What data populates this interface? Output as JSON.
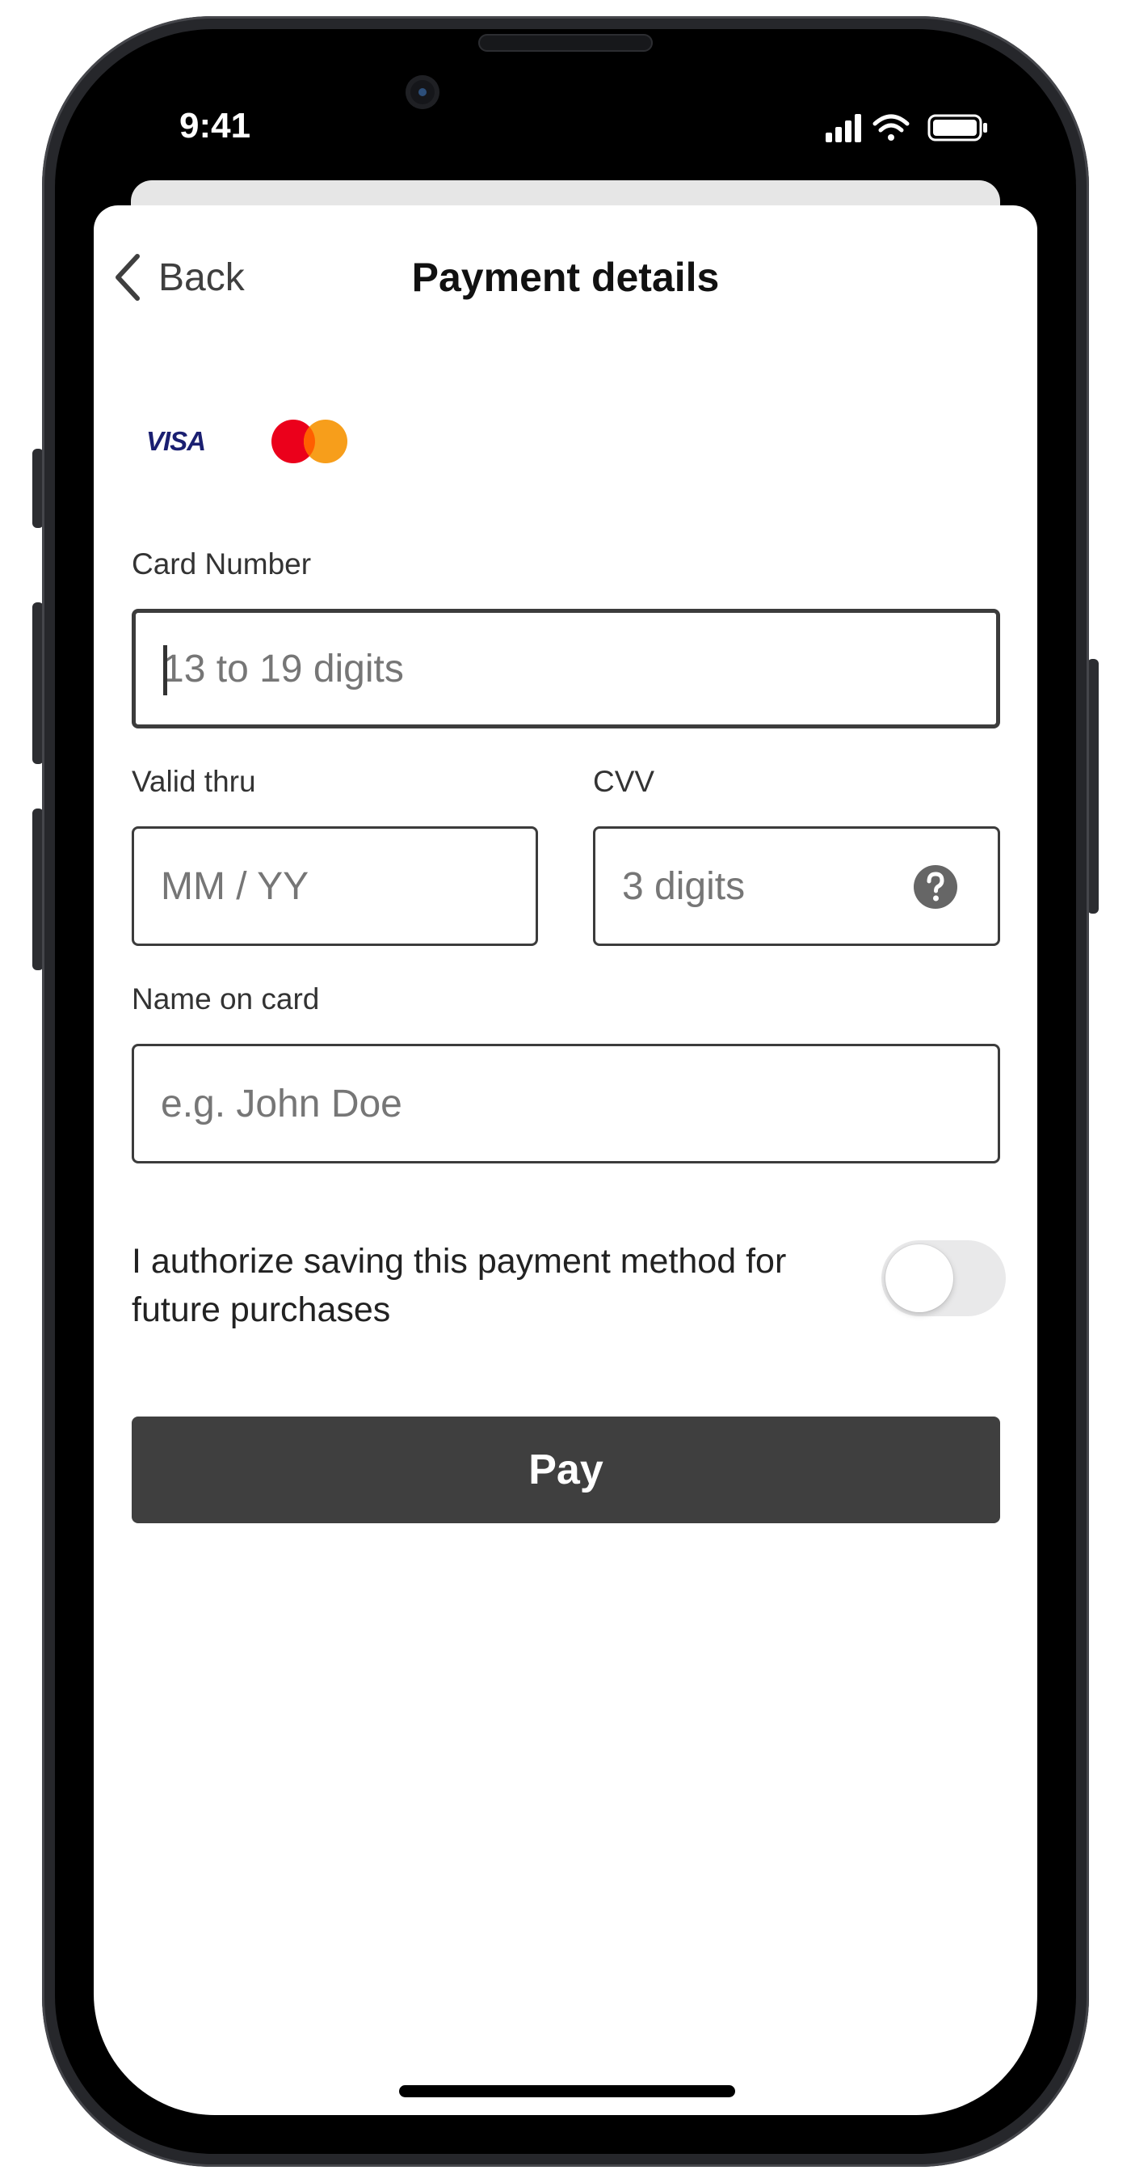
{
  "status_bar": {
    "time": "9:41"
  },
  "header": {
    "back_label": "Back",
    "title": "Payment details"
  },
  "card_brands": {
    "visa": "VISA",
    "mastercard_colors": [
      "#eb001b",
      "#f79e1b"
    ]
  },
  "form": {
    "card_number": {
      "label": "Card Number",
      "placeholder": "13 to 19 digits",
      "value": ""
    },
    "valid_thru": {
      "label": "Valid thru",
      "placeholder": "MM / YY",
      "value": ""
    },
    "cvv": {
      "label": "CVV",
      "placeholder": "3 digits",
      "value": ""
    },
    "name_on_card": {
      "label": "Name on card",
      "placeholder": "e.g. John Doe",
      "value": ""
    }
  },
  "consent": {
    "text": "I authorize saving this payment method for future purchases",
    "enabled": false
  },
  "pay_button": {
    "label": "Pay"
  },
  "colors": {
    "primary_button": "#3f3f3f",
    "toggle_off": "#e9e9ea",
    "visa_blue": "#1a1f71"
  },
  "icons": [
    "chevron-left-icon",
    "help-icon",
    "signal-icon",
    "wifi-icon",
    "battery-icon"
  ]
}
